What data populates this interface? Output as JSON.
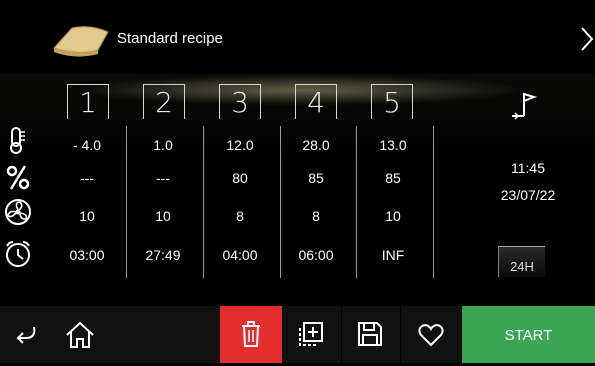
{
  "header": {
    "title": "Standard recipe"
  },
  "phases": [
    "1",
    "2",
    "3",
    "4",
    "5"
  ],
  "rows": {
    "temperature": [
      "- 4.0",
      "1.0",
      "12.0",
      "28.0",
      "13.0"
    ],
    "humidity": [
      "---",
      "---",
      "80",
      "85",
      "85"
    ],
    "fan": [
      "10",
      "10",
      "8",
      "8",
      "10"
    ],
    "time": [
      "03:00",
      "27:49",
      "04:00",
      "06:00",
      "INF"
    ]
  },
  "side": {
    "time": "11:45",
    "date": "23/07/22",
    "btn24": "24H"
  },
  "footer": {
    "start_label": "START"
  },
  "icons": {
    "logo": "bread-dough-icon",
    "back": "chevron-right-icon",
    "end": "flag-end-icon",
    "temperature": "thermometer-icon",
    "humidity": "percent-icon",
    "fan": "fan-icon",
    "time": "alarm-clock-icon",
    "return": "return-arrow-icon",
    "home": "home-icon",
    "delete": "trash-icon",
    "add": "add-phase-icon",
    "save": "save-icon",
    "favorite": "heart-icon"
  },
  "colors": {
    "delete": "#e42d2d",
    "start": "#3aa554",
    "footer": "#111111"
  }
}
